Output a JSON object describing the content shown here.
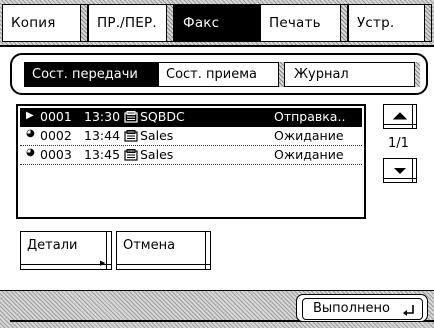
{
  "tabs": [
    {
      "label": "Копия",
      "active": false
    },
    {
      "label": "ПР./ПЕР.",
      "active": false
    },
    {
      "label": "Факс",
      "active": true
    },
    {
      "label": "Печать",
      "active": false
    },
    {
      "label": "Устр.",
      "active": false
    }
  ],
  "subtabs": [
    {
      "label": "Сост. передачи",
      "active": true
    },
    {
      "label": "Сост. приема",
      "active": false
    },
    {
      "label": "Журнал",
      "active": false
    }
  ],
  "jobs": [
    {
      "number": "0001",
      "time": "13:30",
      "dest": "SQBDC",
      "status": "Отправка..",
      "selected": true
    },
    {
      "number": "0002",
      "time": "13:44",
      "dest": "Sales",
      "status": "Ожидание",
      "selected": false
    },
    {
      "number": "0003",
      "time": "13:45",
      "dest": "Sales",
      "status": "Ожидание",
      "selected": false
    }
  ],
  "page_indicator": "1/1",
  "buttons": {
    "details": "Детали",
    "cancel": "Отмена",
    "done": "Выполнено"
  }
}
